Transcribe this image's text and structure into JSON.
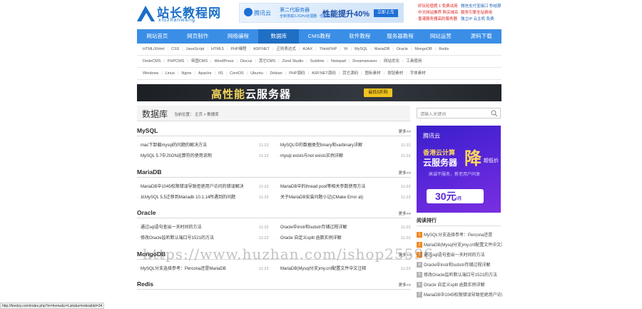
{
  "header": {
    "logo_cn": "站长教程网",
    "logo_en": "xiuzhanwang",
    "ad": {
      "brand": "腾讯云",
      "generation": "第二代服务器",
      "config": "全新搭载3.2GHz处理器 · 性能提升",
      "perf": "性能提升40%",
      "button": "立即上车"
    },
    "promo": [
      {
        "text": "好玩轮值假 1 免费试用",
        "color": "#e02020"
      },
      {
        "text": "微信支付宝接口 秒结算",
        "color": "#1a5fb4"
      },
      {
        "text": "中文网站推荐 购买域名",
        "color": "#e02020"
      },
      {
        "text": "服务引擎全站费用",
        "color": "#e02020"
      },
      {
        "text": "香港服务器高防服务器",
        "color": "#e02020"
      },
      {
        "text": "独立IP 云主机 免费",
        "color": "#1a5fb4"
      }
    ]
  },
  "nav": {
    "items": [
      "网站首页",
      "网页制作",
      "网络编程",
      "数据库",
      "CMS教程",
      "软件教程",
      "服务器教程",
      "网站运营",
      "源码下载"
    ],
    "active_index": 3
  },
  "subnav": [
    [
      "HTML/Xhtml",
      "CSS",
      "JavaScript",
      "HTML5",
      "PHP编程",
      "ASP.NET",
      "正则表达式",
      "AJAX",
      "ThinkPHP",
      "Yii",
      "MySQL",
      "MariaDB",
      "Oracle",
      "MongoDB",
      "Redis"
    ],
    [
      "DedeCMS",
      "PHPCMS",
      "帝国CMS",
      "WordPress",
      "Discuz",
      "其它CMS",
      "Zend Studio",
      "Sublime",
      "Notepad",
      "Dreamweaver",
      "网站优化",
      "工具使用"
    ],
    [
      "Windows",
      "Linux",
      "Nginx",
      "Apache",
      "IIS",
      "CentOS",
      "Ubuntu",
      "Debian",
      "PHP源码",
      "ASP.NET源码",
      "其它源码",
      "图标素材",
      "按钮素材",
      "字体素材"
    ]
  ],
  "banner": {
    "text_colored": "高性能",
    "text_white": "云服务器",
    "button": "最低5折购"
  },
  "page": {
    "title": "数据库",
    "crumb": "当前位置： 主页 > 数据库"
  },
  "search": {
    "placeholder": "请输入关键词"
  },
  "sections": [
    {
      "name": "MySQL",
      "more": "更多>>",
      "items": [
        {
          "title": "mac下卸载mysql的问题的解决方法",
          "date": "11-22"
        },
        {
          "title": "MySQL中的数据类型binary和varbinary详解",
          "date": "11-22"
        },
        {
          "title": "MySQL 5.7中JSON运算符的使用说明",
          "date": "11-22"
        },
        {
          "title": "mysql exists与not exists实例详解",
          "date": "11-22"
        }
      ]
    },
    {
      "name": "MariaDB",
      "more": "更多>>",
      "items": [
        {
          "title": "MariaDB中1045权限错误导致拒绝用户访问的错误解决",
          "date": "11-22"
        },
        {
          "title": "MariaDB中的thread pool等相关参数使用方法",
          "date": "11-22"
        },
        {
          "title": "从MySQL 5.5迁移到Mariadb 10.1.14所遇到的问题",
          "date": "11-22"
        },
        {
          "title": "关于MariaDB安装问题小记(CMake Error at)",
          "date": "11-22"
        }
      ]
    },
    {
      "name": "Oracle",
      "more": "更多>>",
      "items": [
        {
          "title": "通过sql语句查出一天时间的方法",
          "date": "11-22"
        },
        {
          "title": "Oracle中instr和substr存储过程详解",
          "date": "11-22"
        },
        {
          "title": "修改Oracle监听默认端口号1521的方法",
          "date": "11-22"
        },
        {
          "title": "Oracle 自定义split 函数实例详解",
          "date": "11-22"
        }
      ]
    },
    {
      "name": "MongoDB",
      "more": "更多>>",
      "items": [
        {
          "title": "MySQL分支选择参考：Percona还是MariaDB",
          "date": "11-22"
        },
        {
          "title": "MariaDB(Mysql分支)my.cnf配置文件中文注释",
          "date": "11-22"
        }
      ]
    },
    {
      "name": "Redis",
      "more": "更多>>",
      "items": []
    }
  ],
  "right_ad": {
    "brand": "腾讯云",
    "line1": "香港云计算",
    "line2": "云服务器",
    "big": "降",
    "line3": "超低价",
    "line4": "高诚不服务，新老用户同享",
    "price": "30元",
    "unit": "/月"
  },
  "ranking": {
    "title": "阅读排行",
    "items": [
      "MySQL分支选择参考：Percona还是",
      "MariaDB(Mysql分支)my.cnf配置文件中文注",
      "通过sql语句查出一天时间的方法",
      "Oracle中instr和substr存储过程详解",
      "修改Oracle监听默认端口号1521的方法",
      "Oracle 自定义split 函数实例详解",
      "MariaDB中1045权限错误导致拒绝用户访问"
    ],
    "colors": [
      "#f08a24",
      "#f08a24",
      "#f08a24",
      "#b5b5b5",
      "#b5b5b5",
      "#b5b5b5",
      "#b5b5b5"
    ]
  },
  "watermark": "https://www.huzhan.com/ishop25596",
  "status_bar": "http://feedzy.com/index.php?m=home&c=Lists&a=index&tid=34"
}
